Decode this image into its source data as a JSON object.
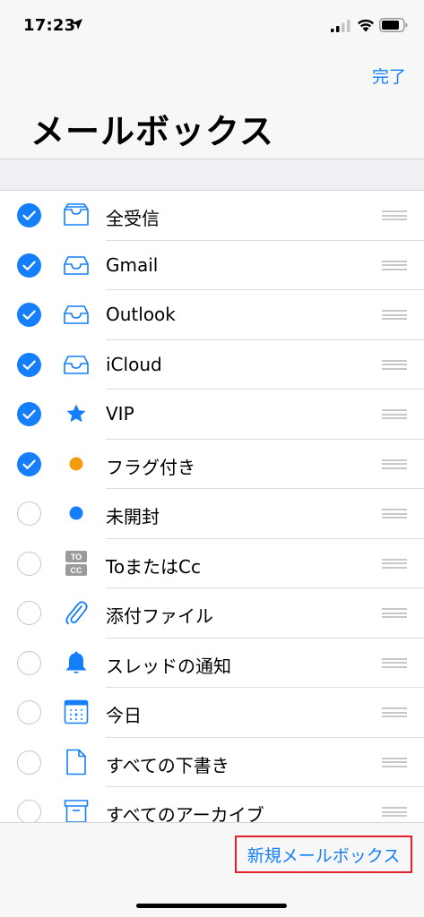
{
  "status_bar": {
    "time": "17:23"
  },
  "nav": {
    "done_label": "完了",
    "title": "メールボックス"
  },
  "colors": {
    "accent": "#147efb",
    "flag": "#f39c12",
    "unread": "#147efb",
    "highlight": "#e0202a",
    "gray_icon": "#9b9b9b"
  },
  "mailboxes": [
    {
      "label": "全受信",
      "checked": true,
      "icon": "tray-stack-icon"
    },
    {
      "label": "Gmail",
      "checked": true,
      "icon": "tray-icon"
    },
    {
      "label": "Outlook",
      "checked": true,
      "icon": "tray-icon"
    },
    {
      "label": "iCloud",
      "checked": true,
      "icon": "tray-icon"
    },
    {
      "label": "VIP",
      "checked": true,
      "icon": "star-icon"
    },
    {
      "label": "フラグ付き",
      "checked": true,
      "icon": "flag-dot-icon"
    },
    {
      "label": "未開封",
      "checked": false,
      "icon": "unread-dot-icon"
    },
    {
      "label": "ToまたはCc",
      "checked": false,
      "icon": "to-cc-icon",
      "icon_text": {
        "to": "TO",
        "cc": "CC"
      }
    },
    {
      "label": "添付ファイル",
      "checked": false,
      "icon": "paperclip-icon"
    },
    {
      "label": "スレッドの通知",
      "checked": false,
      "icon": "bell-icon"
    },
    {
      "label": "今日",
      "checked": false,
      "icon": "calendar-icon"
    },
    {
      "label": "すべての下書き",
      "checked": false,
      "icon": "document-icon"
    },
    {
      "label": "すべてのアーカイブ",
      "checked": false,
      "icon": "archive-box-icon"
    }
  ],
  "toolbar": {
    "new_mailbox_label": "新規メールボックス"
  }
}
